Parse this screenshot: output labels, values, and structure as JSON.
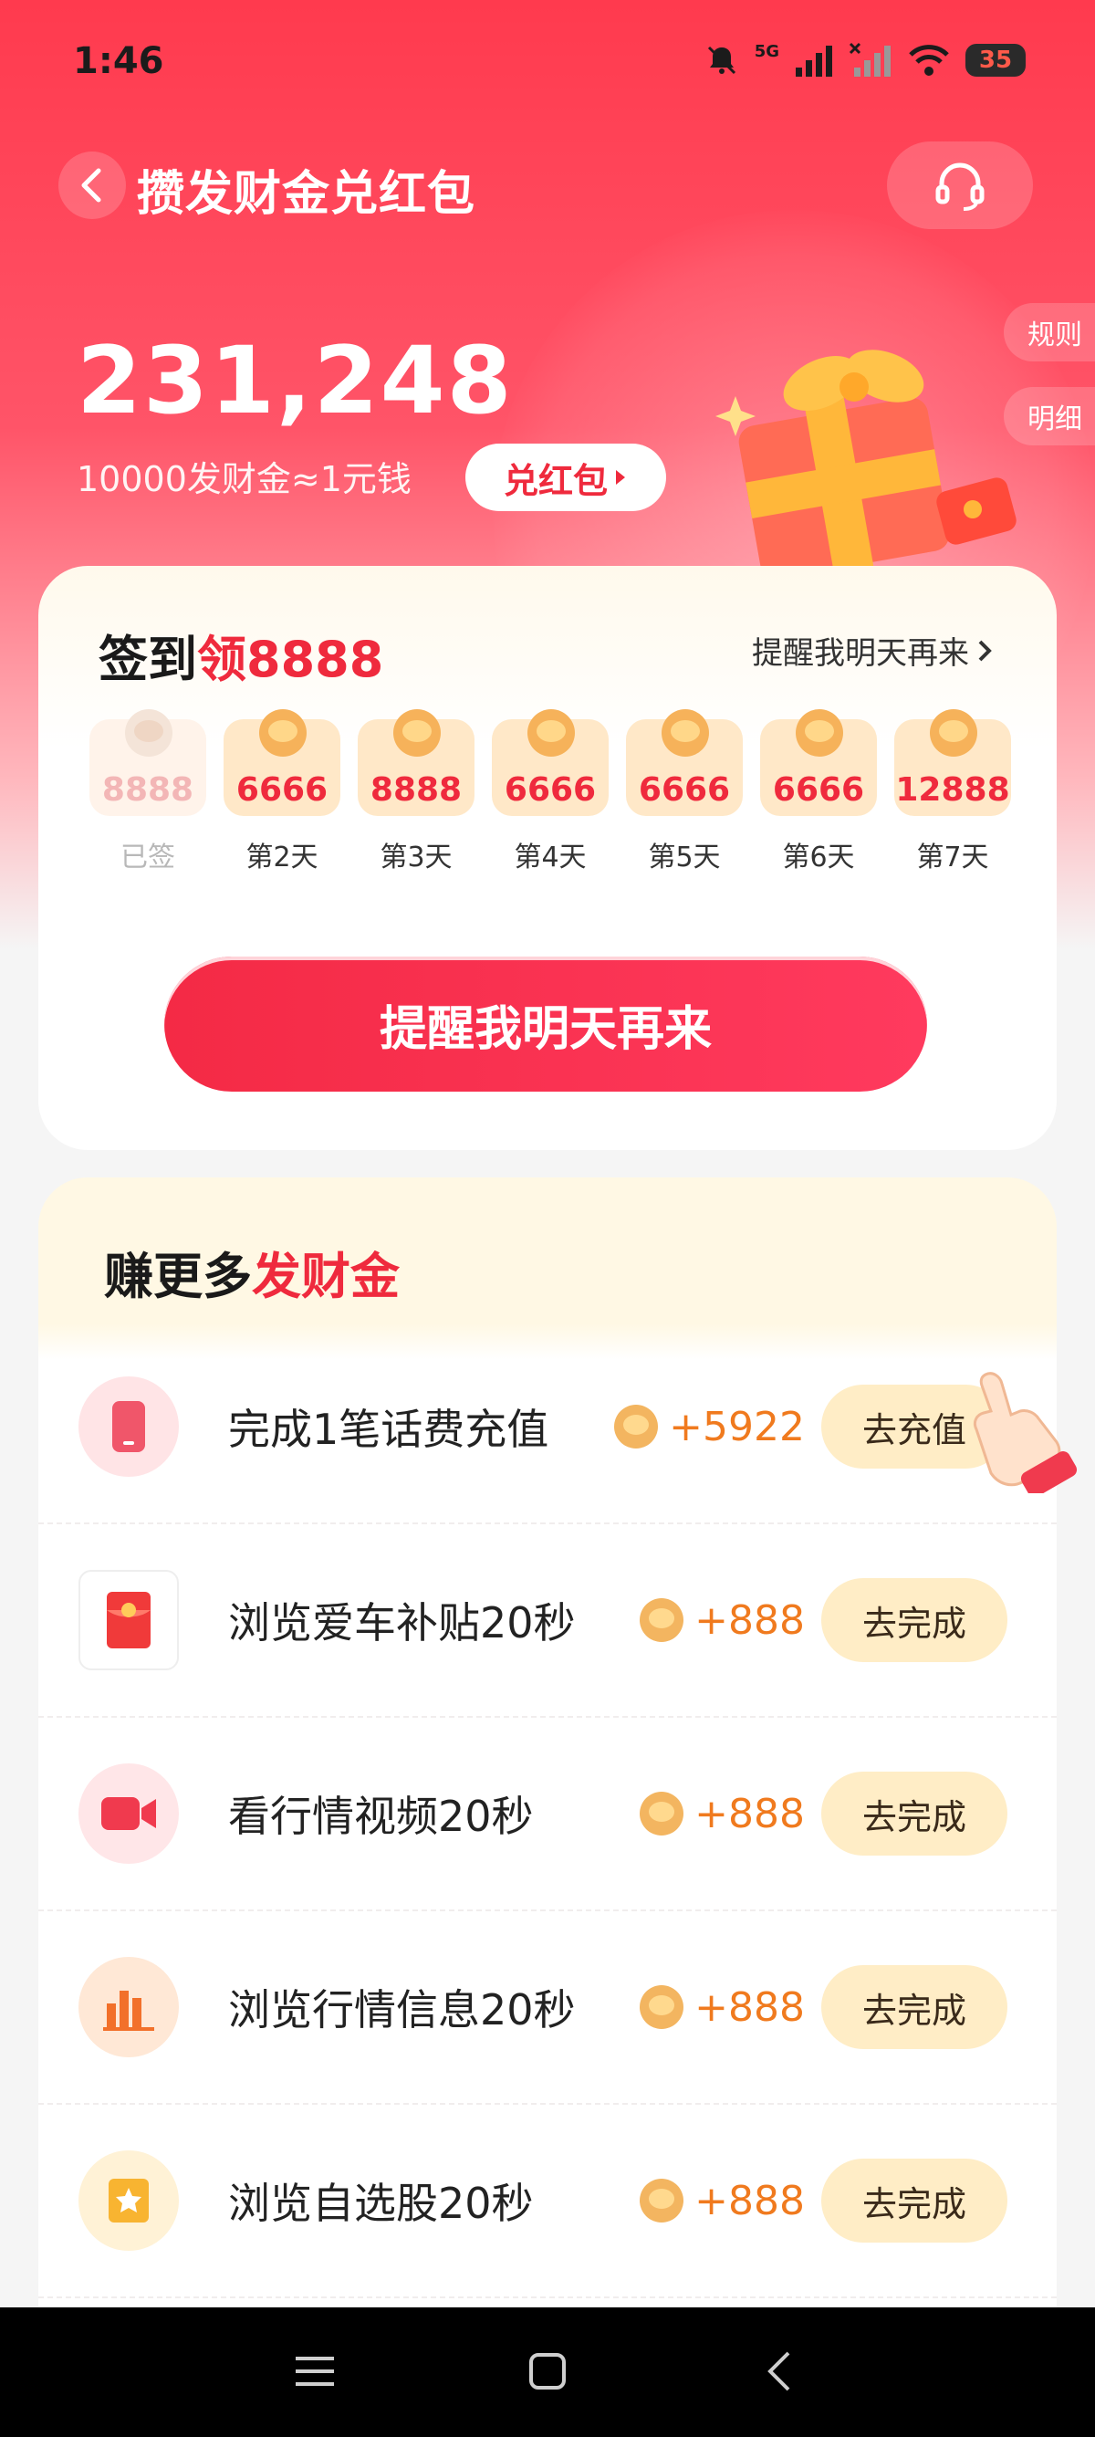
{
  "status_bar": {
    "time": "1:46",
    "network": "5G",
    "battery": "35"
  },
  "header": {
    "title": "攒发财金兑红包",
    "side_links": [
      "规则",
      "明细"
    ]
  },
  "balance": {
    "points": "231,248",
    "rate": "10000发财金≈1元钱",
    "redeem_label": "兑红包"
  },
  "signin": {
    "title_prefix": "签到",
    "title_highlight": "领8888",
    "remind_link": "提醒我明天再来",
    "days": [
      {
        "value": "8888",
        "label": "已签",
        "done": true
      },
      {
        "value": "6666",
        "label": "第2天",
        "done": false
      },
      {
        "value": "8888",
        "label": "第3天",
        "done": false
      },
      {
        "value": "6666",
        "label": "第4天",
        "done": false
      },
      {
        "value": "6666",
        "label": "第5天",
        "done": false
      },
      {
        "value": "6666",
        "label": "第6天",
        "done": false
      },
      {
        "value": "12888",
        "label": "第7天",
        "done": false
      }
    ],
    "button_label": "提醒我明天再来"
  },
  "earn": {
    "title_prefix": "赚更多",
    "title_highlight": "发财金",
    "tasks": [
      {
        "name": "完成1笔话费充值",
        "reward": "+5922",
        "button": "去充值",
        "icon": "phone-icon"
      },
      {
        "name": "浏览爱车补贴20秒",
        "reward": "+888",
        "button": "去完成",
        "icon": "red-envelope-icon"
      },
      {
        "name": "看行情视频20秒",
        "reward": "+888",
        "button": "去完成",
        "icon": "video-camera-icon"
      },
      {
        "name": "浏览行情信息20秒",
        "reward": "+888",
        "button": "去完成",
        "icon": "bar-chart-icon"
      },
      {
        "name": "浏览自选股20秒",
        "reward": "+888",
        "button": "去完成",
        "icon": "star-icon"
      }
    ]
  },
  "colors": {
    "brand_red": "#ef2a3d",
    "reward_orange": "#f07a1e",
    "button_cream": "#ffedc6"
  }
}
